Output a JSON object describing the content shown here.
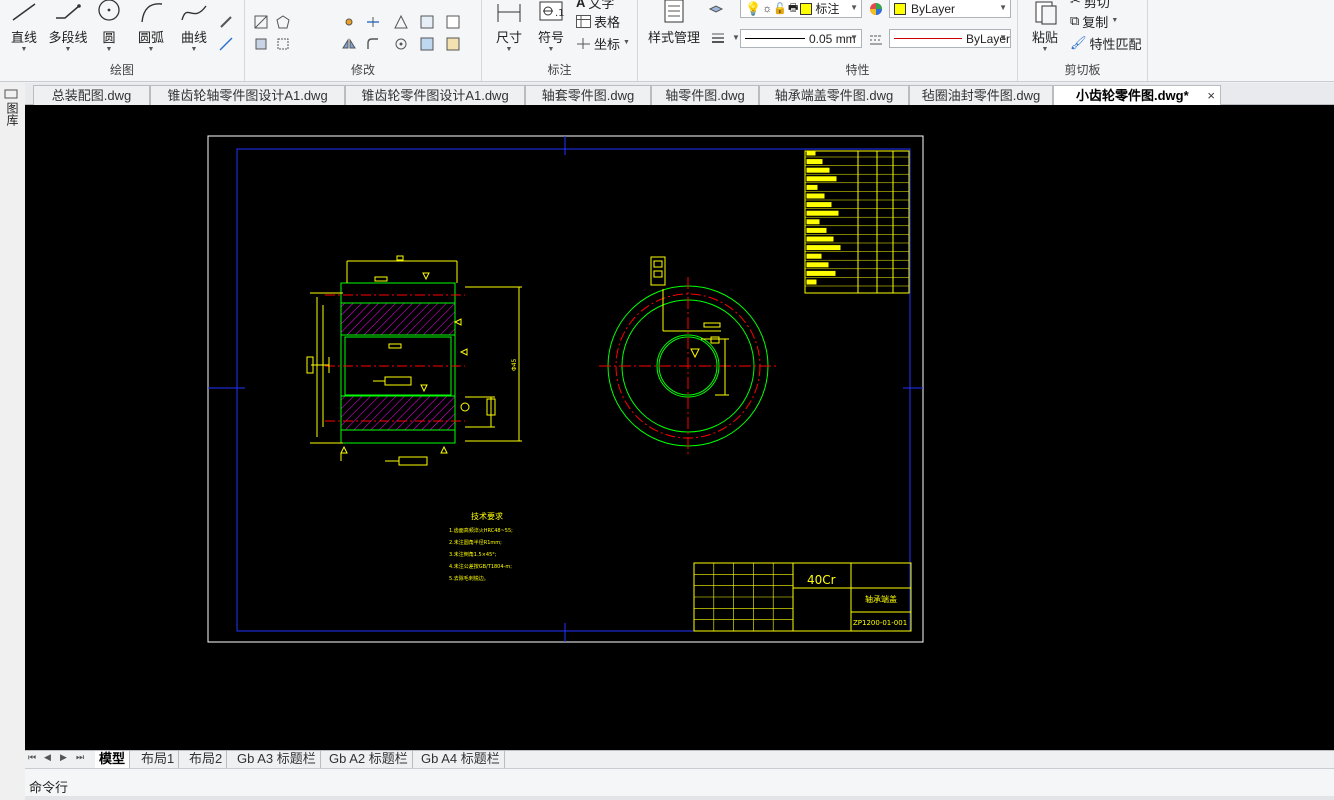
{
  "ribbon": {
    "draw": {
      "title": "绘图",
      "line": "直线",
      "polyline": "多段线",
      "circle": "圆",
      "arc": "圆弧",
      "curve": "曲线"
    },
    "modify": {
      "title": "修改"
    },
    "annotate": {
      "title": "标注",
      "dimension": "尺寸",
      "symbol": "符号",
      "text": "文字",
      "table": "表格",
      "coord": "坐标"
    },
    "style": {
      "label": "样式管理"
    },
    "properties": {
      "title": "特性",
      "layer": "标注",
      "color": "ByLayer",
      "lineweight": "0.05 mm",
      "linetype": "ByLayer"
    },
    "clipboard": {
      "title": "剪切板",
      "paste": "粘贴",
      "cut": "剪切",
      "copy": "复制",
      "match": "特性匹配"
    }
  },
  "left_strip": {
    "label": "图库"
  },
  "tabs": [
    {
      "label": "总装配图.dwg"
    },
    {
      "label": "锥齿轮轴零件图设计A1.dwg"
    },
    {
      "label": "锥齿轮零件图设计A1.dwg"
    },
    {
      "label": "轴套零件图.dwg"
    },
    {
      "label": "轴零件图.dwg"
    },
    {
      "label": "轴承端盖零件图.dwg"
    },
    {
      "label": "毡圈油封零件图.dwg"
    },
    {
      "label": "小齿轮零件图.dwg*",
      "close": "×"
    }
  ],
  "drawing": {
    "tech_title": "技术要求",
    "tech_notes": [
      "1.齿面高频淬火HRC48~55;",
      "2.未注圆角半径R1mm;",
      "3.未注倒角1.5×45°;",
      "4.未注公差按GB/T1804-m;",
      "5.去除毛刺锐边。"
    ],
    "material": "40Cr",
    "part_name": "轴承端盖",
    "drawing_no": "ZP1200-01-001",
    "dim_vertical": "Φ45"
  },
  "layout_tabs": [
    "模型",
    "布局1",
    "布局2",
    "Gb A3 标题栏",
    "Gb A2 标题栏",
    "Gb A4 标题栏"
  ],
  "nav_arrows": [
    "⏮",
    "◀",
    "▶",
    "⏭"
  ],
  "command": {
    "label": "命令行"
  },
  "colors": {
    "canvas": "#000000",
    "frame": "#ffffff",
    "border": "#0000ff",
    "dim": "#ffff00",
    "outline": "#00ff00",
    "center": "#ff0000",
    "hatch": "#ff00ff"
  }
}
